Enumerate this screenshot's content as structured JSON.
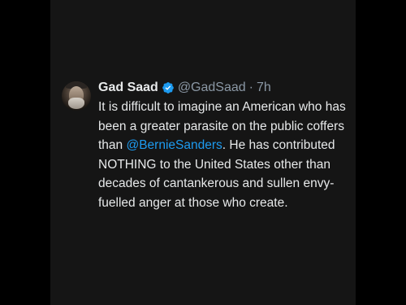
{
  "tweet": {
    "author_name": "Gad Saad",
    "handle": "@GadSaad",
    "separator": "·",
    "time": "7h",
    "text_part1": "It is difficult to imagine an American who has been a greater parasite on the public coffers than ",
    "mention": "@BernieSanders",
    "text_part2": ".  He has contributed NOTHING to the United States other than decades of cantankerous and sullen envy-fuelled anger at those who create.",
    "verified_icon": "verified-badge-icon",
    "colors": {
      "background": "#151515",
      "text": "#e7e9ea",
      "muted": "#8b98a5",
      "link": "#1d9bf0"
    }
  }
}
